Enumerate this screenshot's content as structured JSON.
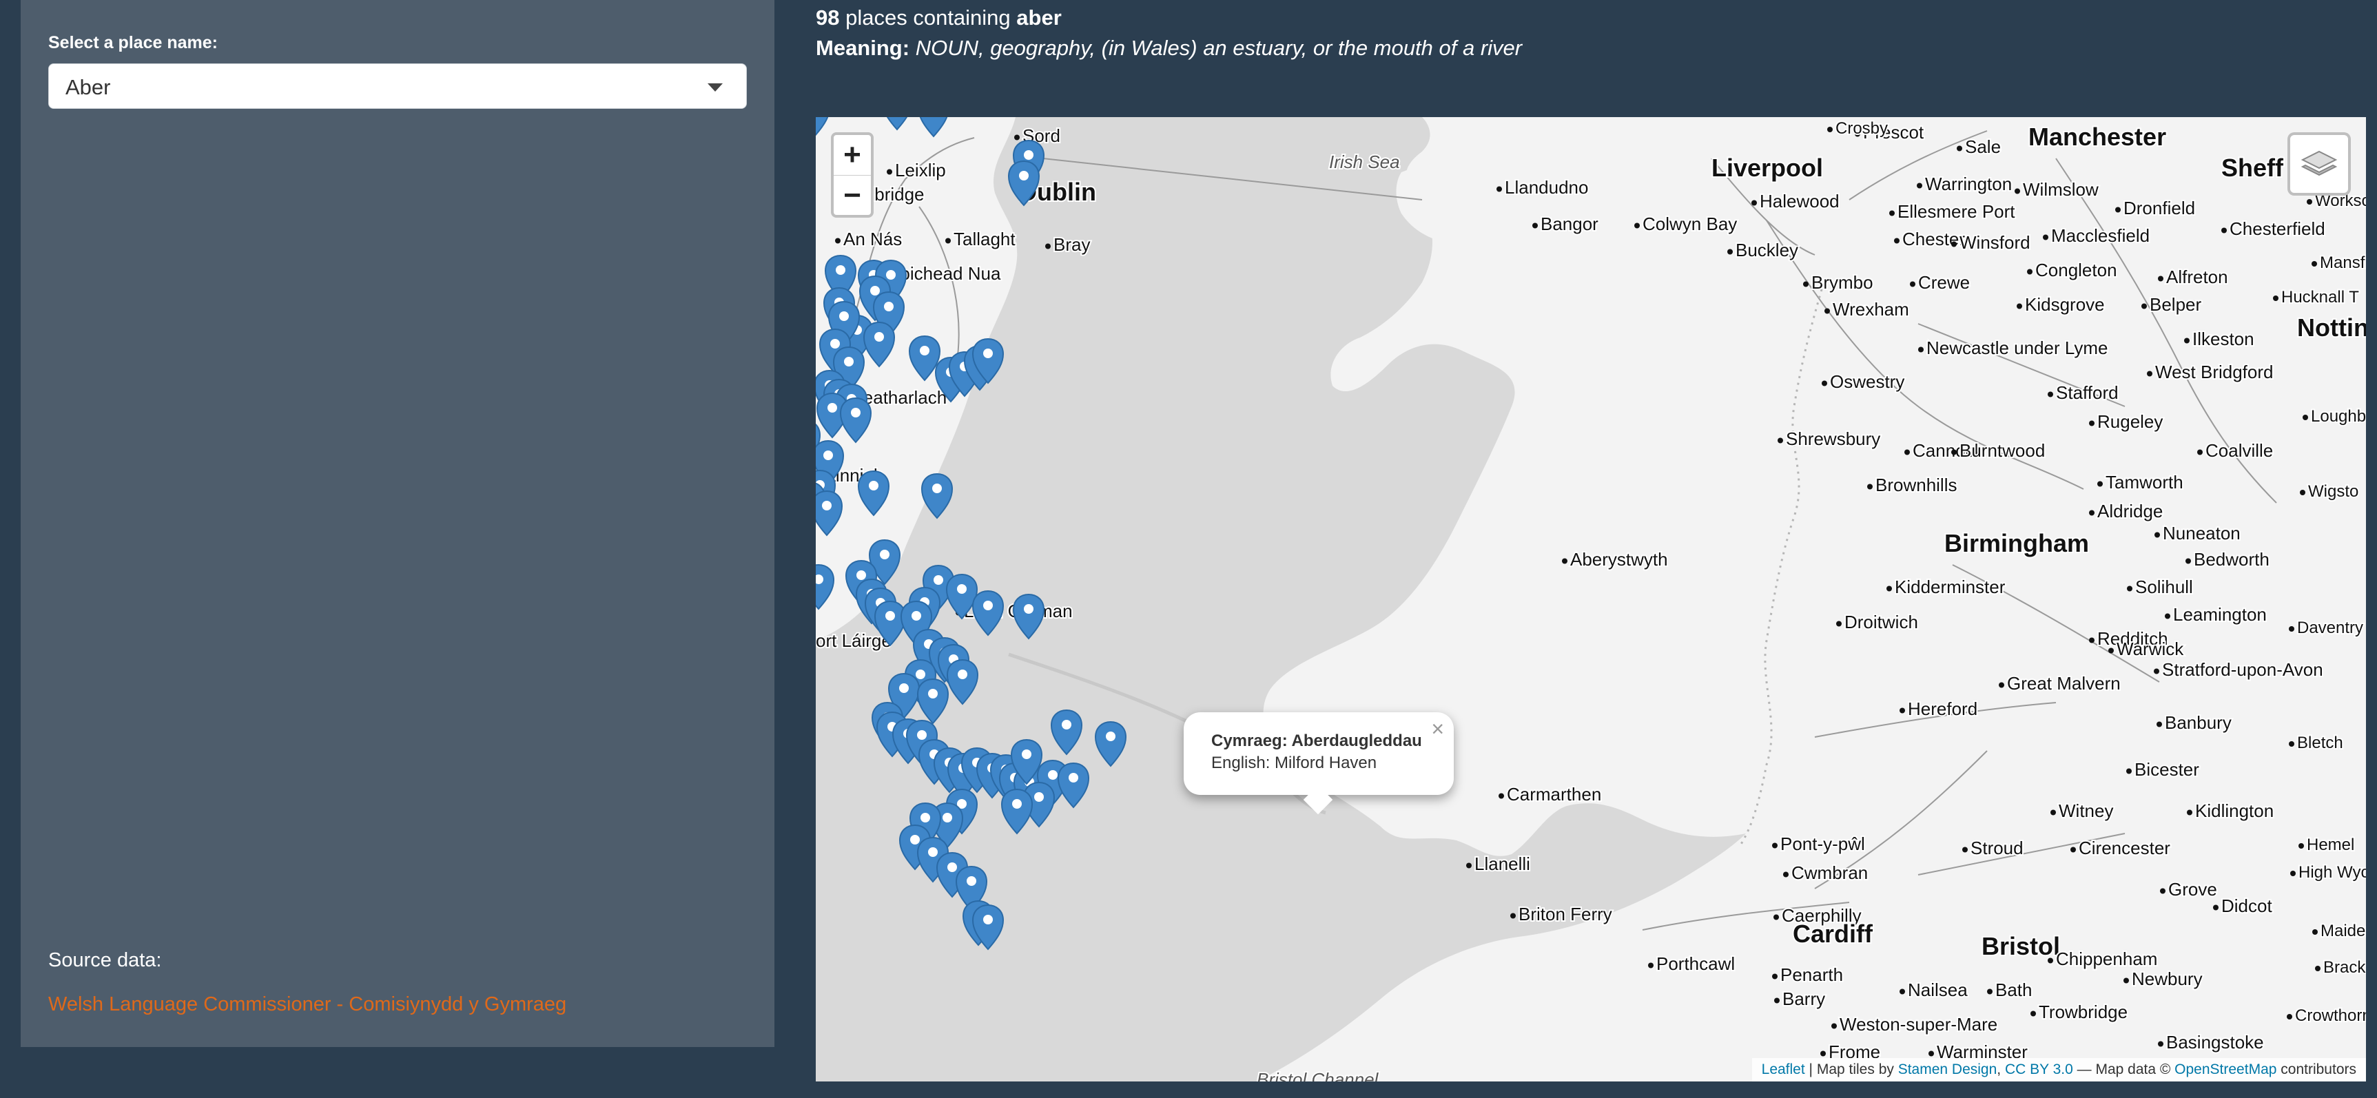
{
  "sidebar": {
    "select_label": "Select a place name:",
    "selected_value": "Aber",
    "source_label": "Source data:",
    "source_link": "Welsh Language Commissioner - Comisiynydd y Gymraeg"
  },
  "header": {
    "count": "98",
    "count_text": "places containing",
    "term": "aber",
    "meaning_label": "Meaning:",
    "meaning_text": "NOUN, geography, (in Wales) an estuary, or the mouth of a river"
  },
  "map": {
    "zoom_in": "+",
    "zoom_out": "−",
    "popup": {
      "line1": "Cymraeg: Aberdaugleddau",
      "line2": "English: Milford Haven",
      "close": "×"
    },
    "attribution": {
      "leaflet": "Leaflet",
      "sep1": " | Map tiles by ",
      "stamen": "Stamen Design",
      "comma": ", ",
      "cc": "CC BY 3.0",
      "sep2": " — Map data © ",
      "osm": "OpenStreetMap",
      "contributors": " contributors"
    },
    "labels": [
      {
        "text": "Sord"
      },
      {
        "text": "Leixlip"
      },
      {
        "text": "elbridge"
      },
      {
        "text": "Dublin"
      },
      {
        "text": "An Nás"
      },
      {
        "text": "Tallaght"
      },
      {
        "text": "Bray"
      },
      {
        "text": "Droichead Nua"
      },
      {
        "text": "Ceatharlach"
      },
      {
        "text": "hainnigh"
      },
      {
        "text": "Loch Garman"
      },
      {
        "text": "ort Láirge"
      },
      {
        "text": "Irish Sea"
      },
      {
        "text": "Llandudno"
      },
      {
        "text": "Bangor"
      },
      {
        "text": "Colwyn Bay"
      },
      {
        "text": "Liverpool"
      },
      {
        "text": "Halewood"
      },
      {
        "text": "Prescot"
      },
      {
        "text": "Crosby"
      },
      {
        "text": "Manchester"
      },
      {
        "text": "Sale"
      },
      {
        "text": "Sheff"
      },
      {
        "text": "Warrington"
      },
      {
        "text": "Ellesmere Port"
      },
      {
        "text": "Wilmslow"
      },
      {
        "text": "Dronfield"
      },
      {
        "text": "Workso"
      },
      {
        "text": "Chester"
      },
      {
        "text": "Winsford"
      },
      {
        "text": "Macclesfield"
      },
      {
        "text": "Chesterfield"
      },
      {
        "text": "Buckley"
      },
      {
        "text": "Mansfield"
      },
      {
        "text": "Brymbo"
      },
      {
        "text": "Crewe"
      },
      {
        "text": "Congleton"
      },
      {
        "text": "Alfreton"
      },
      {
        "text": "Hucknall T"
      },
      {
        "text": "Wrexham"
      },
      {
        "text": "Kidsgrove"
      },
      {
        "text": "Belper"
      },
      {
        "text": "Nottin"
      },
      {
        "text": "Ilkeston"
      },
      {
        "text": "Newcastle under Lyme"
      },
      {
        "text": "West Bridgford"
      },
      {
        "text": "Oswestry"
      },
      {
        "text": "Stafford"
      },
      {
        "text": "Loughbor"
      },
      {
        "text": "Rugeley"
      },
      {
        "text": "Shrewsbury"
      },
      {
        "text": "Cannock"
      },
      {
        "text": "Burntwood"
      },
      {
        "text": "Coalville"
      },
      {
        "text": "Brownhills"
      },
      {
        "text": "Tamworth"
      },
      {
        "text": "Wigsto"
      },
      {
        "text": "Aldridge"
      },
      {
        "text": "Nuneaton"
      },
      {
        "text": "Birmingham"
      },
      {
        "text": "Bedworth"
      },
      {
        "text": "Aberystwyth"
      },
      {
        "text": "Solihull"
      },
      {
        "text": "Kidderminster"
      },
      {
        "text": "Leamington"
      },
      {
        "text": "Droitwich"
      },
      {
        "text": "Redditch"
      },
      {
        "text": "Warwick"
      },
      {
        "text": "Daventry"
      },
      {
        "text": "Stratford-upon-Avon"
      },
      {
        "text": "Great Malvern"
      },
      {
        "text": "Hereford"
      },
      {
        "text": "Banbury"
      },
      {
        "text": "Bicester"
      },
      {
        "text": "Bletch"
      },
      {
        "text": "Carmarthen"
      },
      {
        "text": "Witney"
      },
      {
        "text": "Kidlington"
      },
      {
        "text": "Pont-y-pŵl"
      },
      {
        "text": "Stroud"
      },
      {
        "text": "Cirencester"
      },
      {
        "text": "Hemel"
      },
      {
        "text": "Cwmbran"
      },
      {
        "text": "Llanelli"
      },
      {
        "text": "High Wycom"
      },
      {
        "text": "Grove"
      },
      {
        "text": "Didcot"
      },
      {
        "text": "Caerphilly"
      },
      {
        "text": "Briton Ferry"
      },
      {
        "text": "Maidenh"
      },
      {
        "text": "Cardiff"
      },
      {
        "text": "Bristol"
      },
      {
        "text": "Chippenham"
      },
      {
        "text": "Porthcawl"
      },
      {
        "text": "Penarth"
      },
      {
        "text": "Newbury"
      },
      {
        "text": "Brackn"
      },
      {
        "text": "Nailsea"
      },
      {
        "text": "Bath"
      },
      {
        "text": "Barry"
      },
      {
        "text": "Trowbridge"
      },
      {
        "text": "Crowthorne"
      },
      {
        "text": "Weston-super-Mare"
      },
      {
        "text": "Basingstoke"
      },
      {
        "text": "Frome"
      },
      {
        "text": "Warminster"
      },
      {
        "text": "Bristol Channel"
      }
    ]
  }
}
